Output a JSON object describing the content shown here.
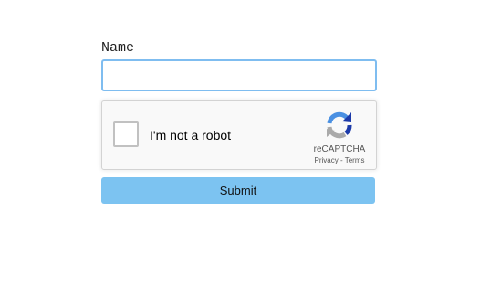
{
  "form": {
    "name_label": "Name",
    "name_value": "",
    "submit_label": "Submit"
  },
  "recaptcha": {
    "checkbox_label": "I'm not a robot",
    "checked": false,
    "brand": "reCAPTCHA",
    "privacy_label": "Privacy",
    "separator": " - ",
    "terms_label": "Terms",
    "logo_icon": "recaptcha-logo"
  },
  "colors": {
    "input_border": "#7fbdf0",
    "submit_bg": "#7cc3f1",
    "captcha_bg": "#f9f9f9",
    "logo_blue": "#1c3aa9",
    "logo_light_blue": "#4a90e2",
    "logo_gray": "#aaaaaa"
  }
}
